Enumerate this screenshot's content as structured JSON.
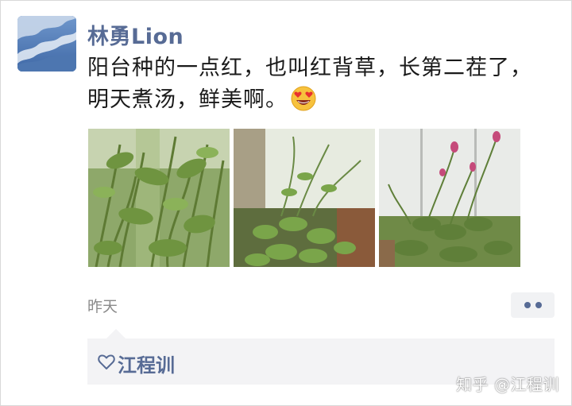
{
  "post": {
    "author": "林勇Lion",
    "text": "阳台种的一点红，也叫红背草，长第二茬了，明天煮汤，鲜美啊。",
    "emoji": "heart-eyes-emoji",
    "photos": [
      {
        "name": "photo-1"
      },
      {
        "name": "photo-2"
      },
      {
        "name": "photo-3"
      }
    ],
    "time": "昨天"
  },
  "likes": {
    "icon": "heart-icon",
    "names": "江程训"
  },
  "watermark": "知乎 @江程训",
  "colors": {
    "link_blue": "#576b95",
    "likes_bg": "#f3f3f5",
    "time_gray": "#8a8a8a"
  }
}
